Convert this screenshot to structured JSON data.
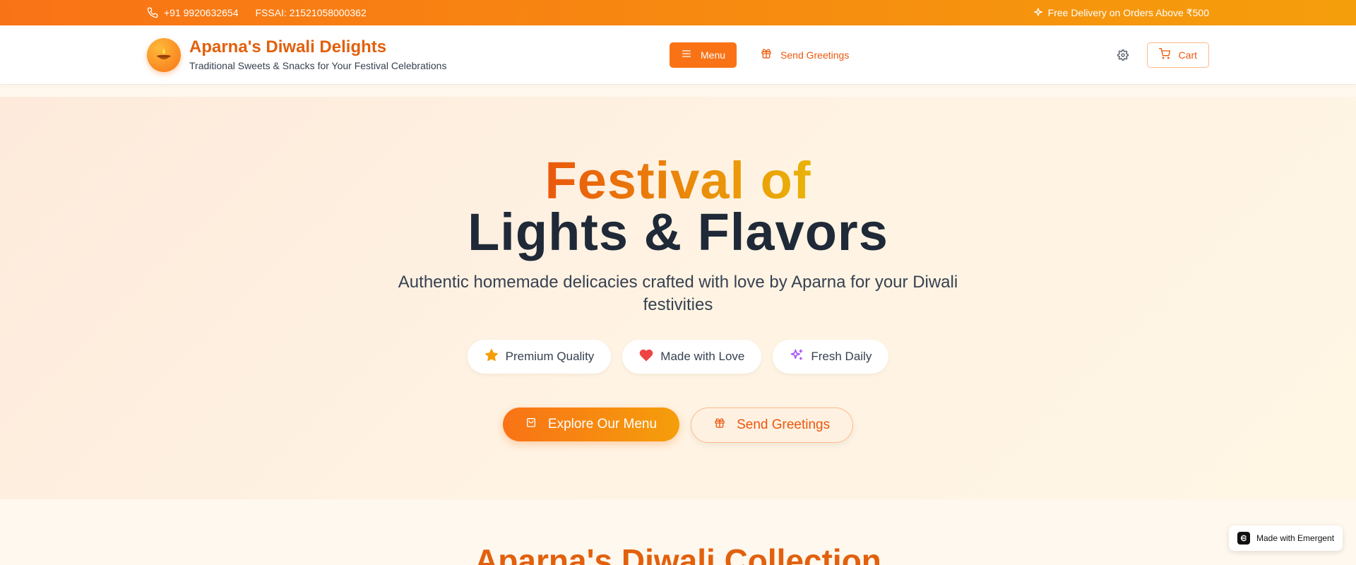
{
  "topbar": {
    "phone": "+91 9920632654",
    "fssai": "FSSAI: 21521058000362",
    "delivery": "Free Delivery on Orders Above ₹500"
  },
  "header": {
    "logo_icon": "diya-lamp-icon",
    "title": "Aparna's Diwali Delights",
    "subtitle": "Traditional Sweets & Snacks for Your Festival Celebrations",
    "nav": {
      "menu_label": "Menu",
      "greetings_label": "Send Greetings"
    },
    "cart_label": "Cart"
  },
  "hero": {
    "title_line1": "Festival of",
    "title_line2": "Lights & Flavors",
    "subtitle": "Authentic homemade delicacies crafted with love by Aparna for your Diwali festivities",
    "features": [
      {
        "label": "Premium Quality",
        "icon": "star-icon",
        "color": "#f59e0b"
      },
      {
        "label": "Made with Love",
        "icon": "heart-icon",
        "color": "#ef4444"
      },
      {
        "label": "Fresh Daily",
        "icon": "sparkles-icon",
        "color": "#a855f7"
      }
    ],
    "cta_primary": "Explore Our Menu",
    "cta_secondary": "Send Greetings"
  },
  "collection": {
    "title": "Aparna's Diwali Collection"
  },
  "badge": {
    "label": "Made with Emergent"
  },
  "colors": {
    "accent": "#f97316",
    "brand_text": "#e2600d",
    "dark_text": "#1f2937"
  }
}
